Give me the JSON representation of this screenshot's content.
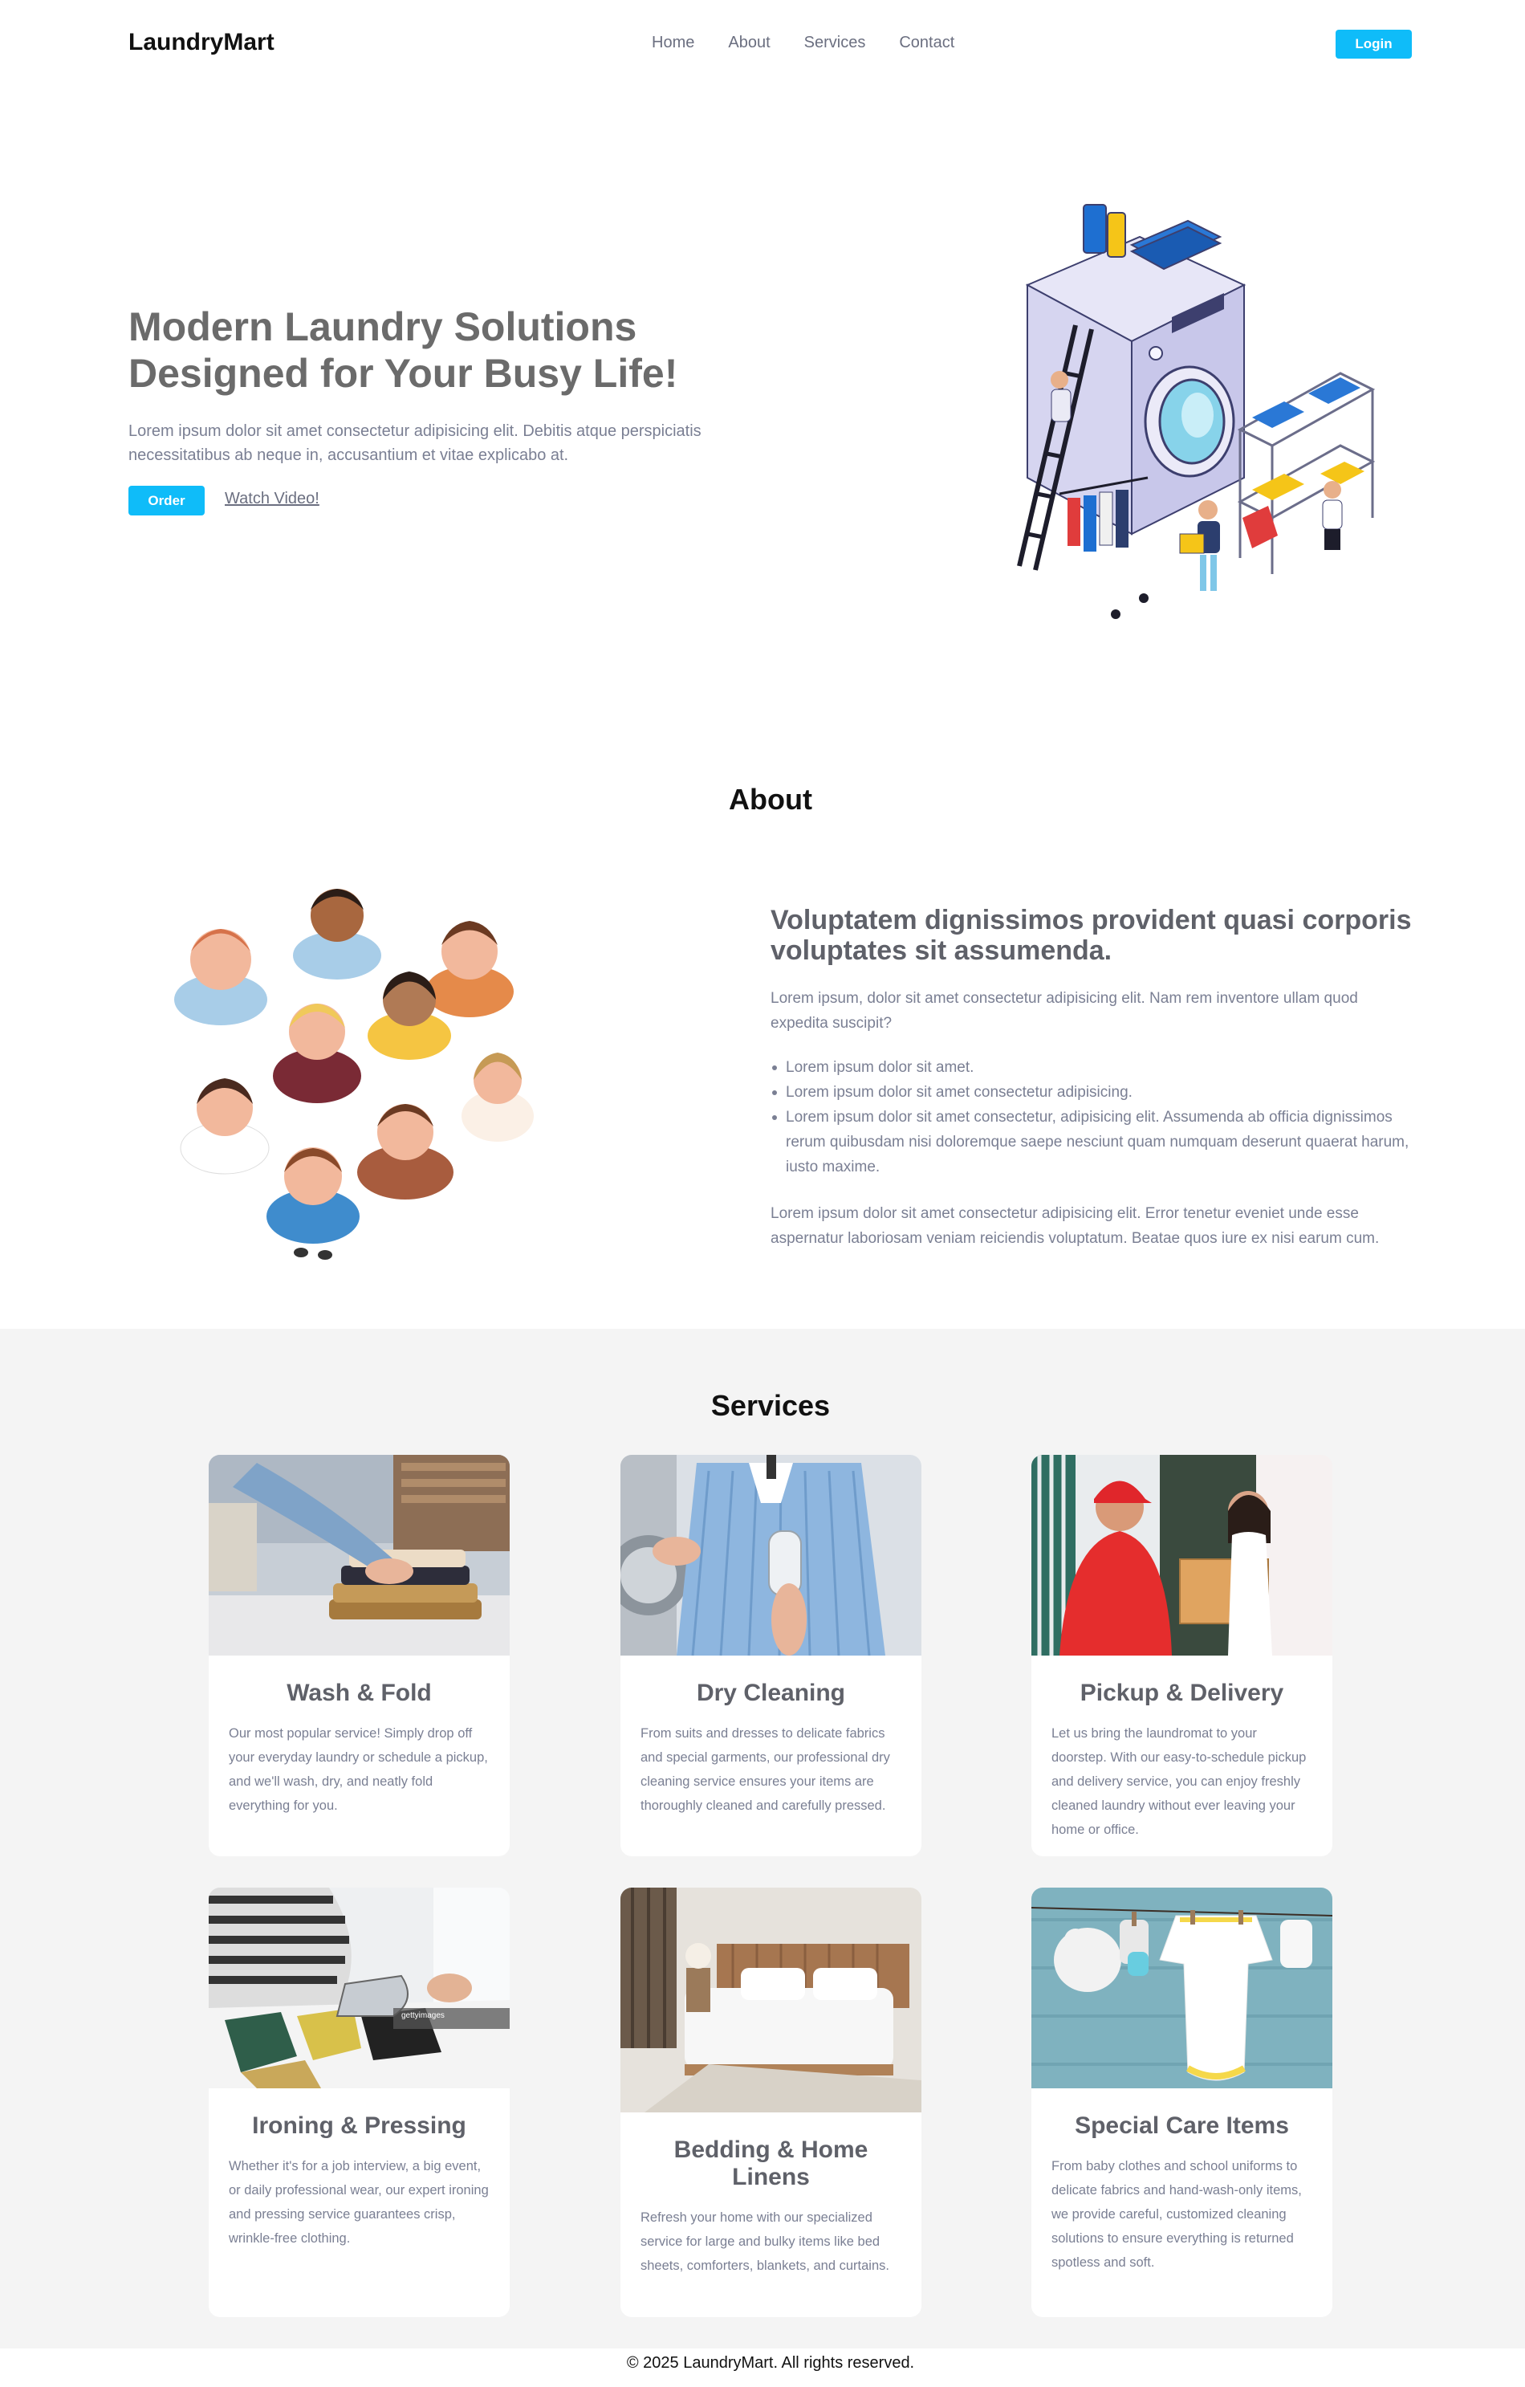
{
  "nav": {
    "logo": "LaundryMart",
    "links": [
      "Home",
      "About",
      "Services",
      "Contact"
    ],
    "login_label": "Login"
  },
  "hero": {
    "title": "Modern Laundry Solutions Designed for Your Busy Life!",
    "text": "Lorem ipsum dolor sit amet consectetur adipisicing elit. Debitis atque perspiciatis necessitatibus ab neque in, accusantium et vitae explicabo at.",
    "order_label": "Order",
    "watch_label": "Watch Video!"
  },
  "about": {
    "heading": "About",
    "subheading": "Voluptatem dignissimos provident quasi corporis voluptates sit assumenda.",
    "paragraph1": "Lorem ipsum, dolor sit amet consectetur adipisicing elit. Nam rem inventore ullam quod expedita suscipit?",
    "bullets": [
      "Lorem ipsum dolor sit amet.",
      "Lorem ipsum dolor sit amet consectetur adipisicing.",
      "Lorem ipsum dolor sit amet consectetur, adipisicing elit. Assumenda ab officia dignissimos rerum quibusdam nisi doloremque saepe nesciunt quam numquam deserunt quaerat harum, iusto maxime."
    ],
    "paragraph2": "Lorem ipsum dolor sit amet consectetur adipisicing elit. Error tenetur eveniet unde esse aspernatur laboriosam veniam reiciendis voluptatum. Beatae quos iure ex nisi earum cum."
  },
  "services": {
    "heading": "Services",
    "cards": [
      {
        "title": "Wash & Fold",
        "text": "Our most popular service! Simply drop off your everyday laundry or schedule a pickup, and we'll wash, dry, and neatly fold everything for you."
      },
      {
        "title": "Dry Cleaning",
        "text": "From suits and dresses to delicate fabrics and special garments, our professional dry cleaning service ensures your items are thoroughly cleaned and carefully pressed."
      },
      {
        "title": "Pickup & Delivery",
        "text": "Let us bring the laundromat to your doorstep. With our easy-to-schedule pickup and delivery service, you can enjoy freshly cleaned laundry without ever leaving your home or office."
      },
      {
        "title": "Ironing & Pressing",
        "text": "Whether it's for a job interview, a big event, or daily professional wear, our expert ironing and pressing service guarantees crisp, wrinkle-free clothing."
      },
      {
        "title": "Bedding & Home Linens",
        "text": "Refresh your home with our specialized service for large and bulky items like bed sheets, comforters, blankets, and curtains."
      },
      {
        "title": "Special Care Items",
        "text": "From baby clothes and school uniforms to delicate fabrics and hand-wash-only items, we provide careful, customized cleaning solutions to ensure everything is returned spotless and soft."
      }
    ],
    "watermark": "gettyimages"
  },
  "footer": {
    "copyright": "© 2025 LaundryMart. All rights reserved."
  },
  "colors": {
    "accent": "#0fbcf9",
    "muted_text": "#7a7f93",
    "services_bg": "#f4f4f4"
  }
}
